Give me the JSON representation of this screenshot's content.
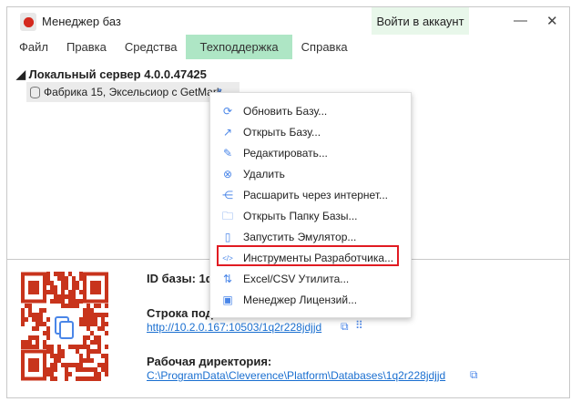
{
  "window": {
    "title": "Менеджер баз",
    "login_label": "Войти в аккаунт",
    "minimize": "—",
    "close": "✕"
  },
  "menubar": [
    {
      "label": "Файл"
    },
    {
      "label": "Правка"
    },
    {
      "label": "Средства"
    },
    {
      "label": "Техподдержка",
      "active": true
    },
    {
      "label": "Справка"
    }
  ],
  "tree": {
    "root": "◢ Локальный сервер 4.0.0.47425",
    "item": "Фабрика 15, Эксельсиор с GetMark"
  },
  "context_menu": [
    {
      "icon": "refresh-icon",
      "glyph": "⟳",
      "label": "Обновить Базу..."
    },
    {
      "icon": "open-external-icon",
      "glyph": "↗",
      "label": "Открыть Базу..."
    },
    {
      "icon": "pencil-icon",
      "glyph": "✎",
      "label": "Редактировать..."
    },
    {
      "icon": "delete-icon",
      "glyph": "⊗",
      "label": "Удалить"
    },
    {
      "icon": "share-icon",
      "glyph": "⋲",
      "label": "Расшарить через интернет..."
    },
    {
      "icon": "folder-icon",
      "glyph": "🗀",
      "label": "Открыть Папку Базы..."
    },
    {
      "icon": "phone-icon",
      "glyph": "▯",
      "label": "Запустить Эмулятор..."
    },
    {
      "icon": "code-icon",
      "glyph": "</>",
      "label": "Инструменты Разработчика...",
      "highlighted": true
    },
    {
      "icon": "import-export-icon",
      "glyph": "⇅",
      "label": "Excel/CSV Утилита..."
    },
    {
      "icon": "license-icon",
      "glyph": "▣",
      "label": "Менеджер Лицензий..."
    }
  ],
  "details": {
    "id_label": "ID базы: 1q2",
    "conn_label": "Строка подк",
    "conn_url": "http://10.2.0.167:10503/1q2r228jdjjd",
    "dir_label": "Рабочая директория:",
    "dir_path": "C:\\ProgramData\\Cleverence\\Platform\\Databases\\1q2r228jdjjd"
  },
  "colors": {
    "accent": "#4a86e8",
    "menu_active": "#aee6c5",
    "qr": "#c8341c",
    "highlight_border": "#e11b22"
  }
}
